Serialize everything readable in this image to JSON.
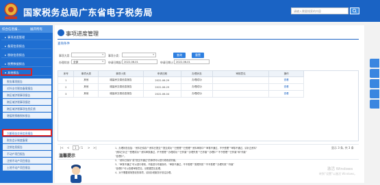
{
  "header": {
    "title": "国家税务总局广东省电子税务局",
    "search_placeholder": "请输入需要搜索的内容",
    "bg_color": "#1a63c4"
  },
  "sidebar": {
    "head_left": "综合信息报...",
    "head_right": "展开所有",
    "items": [
      {
        "label": "事项进度管理"
      },
      {
        "label": "备案信息报告"
      },
      {
        "label": "税收信息报告"
      },
      {
        "label": "税费数据报告"
      },
      {
        "label": "其他报告"
      }
    ],
    "subitems": [
      {
        "label": "税务事项报告"
      },
      {
        "label": "对外支付税务备案报告"
      },
      {
        "label": "跨区域涉税事项报告"
      },
      {
        "label": "跨区域涉税事项报验"
      },
      {
        "label": "跨区域涉税事项信息反馈"
      },
      {
        "label": "增值税预缴税款报告"
      },
      {
        "label": "大额现金交易信息报告"
      },
      {
        "label": "财务会计制度备案"
      },
      {
        "label": "注销信息报告"
      },
      {
        "label": "不动产项目报告"
      },
      {
        "label": "注销不动产项目报告"
      },
      {
        "label": "土地不动产项目报告"
      }
    ]
  },
  "main": {
    "title": "事项进度管理",
    "query_section": "查询条件",
    "filters": {
      "item_category_label": "事项大类：",
      "item_category_value": "",
      "item_subclass_label": "事项小类：",
      "item_subclass_value": "",
      "handle_status_label": "办理状态：",
      "handle_status_value": "全部",
      "apply_date_start_label": "申请日期起：",
      "apply_date_start_value": "2022-06-01",
      "apply_date_end_label": "申请日期止：",
      "apply_date_end_value": "2022-06-01"
    },
    "query_button": "查询",
    "reset_button": "重置",
    "table": {
      "headers": [
        "序号",
        "事项大类",
        "事项小类",
        "申请日期",
        "办理状态",
        "审核意见",
        "操作"
      ],
      "rows": [
        [
          "1",
          "其他",
          "增量房交易信息报告",
          "2022-06-29",
          "办理成功",
          "",
          "查看"
        ],
        [
          "2",
          "其他",
          "增量房交易信息报告",
          "2022-06-29",
          "办理成功",
          "",
          "查看"
        ],
        [
          "3",
          "其他",
          "增量房交易信息报告",
          "2022-06-04",
          "办理成功",
          "",
          "查看"
        ]
      ]
    },
    "pager": {
      "first": "|<",
      "prev": "<",
      "page": "1",
      "of": "/ 1",
      "next": ">",
      "last": ">|",
      "summary": "显示 3 条, 共 3 条"
    },
    "tips_title": "温馨提示",
    "tips": [
      "1、办理状态包括：“资料已保存”“资料已提交”“提交成功”“已受理”“已受理”“资料审核中”“审核不通过、不予受理”“审核不通过，请补正资料”",
      "“资料已补正”“受理成功”“资料审核通过，不予受理”“办理成功”“已作废”“办理失败”“已作废”“办理中”“不予受理”“已作废”和“作废”",
      "   “处理中”。",
      "2、“资料已保存”或“提交不通过”的事项可以进行修改或作废。",
      "3、“审核不通过”可以进行修改，不能进行作废操作。“审核不通过，不予受理”“受理失败”“不予受理”“办理失败”“作废”",
      "   “处理中”可以查看审核意见，请根据意见处理。",
      "4、对于需要现场签收的事项，请到办税服务厅前往办理。"
    ],
    "watermark_line1": "激活 Windows",
    "watermark_line2": "转到“设置”以激活 Windows。"
  }
}
